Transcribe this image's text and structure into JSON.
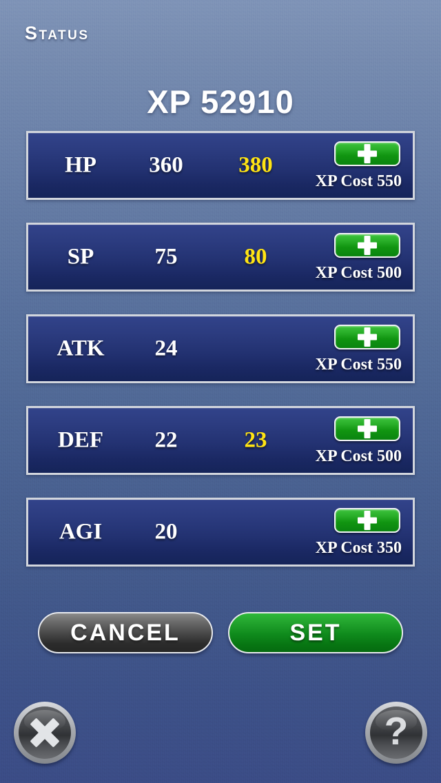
{
  "header": {
    "screen_title": "Status",
    "xp_total_label": "XP 52910"
  },
  "stats": [
    {
      "name": "HP",
      "current": "360",
      "upgraded": "380",
      "cost_label": "XP Cost 550",
      "plus_icon": "plus-icon"
    },
    {
      "name": "SP",
      "current": "75",
      "upgraded": "80",
      "cost_label": "XP Cost 500",
      "plus_icon": "plus-icon"
    },
    {
      "name": "ATK",
      "current": "24",
      "upgraded": "",
      "cost_label": "XP Cost 550",
      "plus_icon": "plus-icon"
    },
    {
      "name": "DEF",
      "current": "22",
      "upgraded": "23",
      "cost_label": "XP Cost 500",
      "plus_icon": "plus-icon"
    },
    {
      "name": "AGI",
      "current": "20",
      "upgraded": "",
      "cost_label": "XP Cost 350",
      "plus_icon": "plus-icon"
    }
  ],
  "actions": {
    "cancel_label": "CANCEL",
    "set_label": "SET"
  },
  "footer": {
    "close_icon": "close-x-icon",
    "help_icon": "question-mark-icon",
    "help_glyph": "?"
  },
  "colors": {
    "upgraded_value": "#ffe414",
    "plus_button_green": "#2ab02a",
    "set_button_green": "#0f8a1c",
    "row_blue": "#233272",
    "background_top": "#7d92b6",
    "background_bottom": "#3a4b84"
  }
}
